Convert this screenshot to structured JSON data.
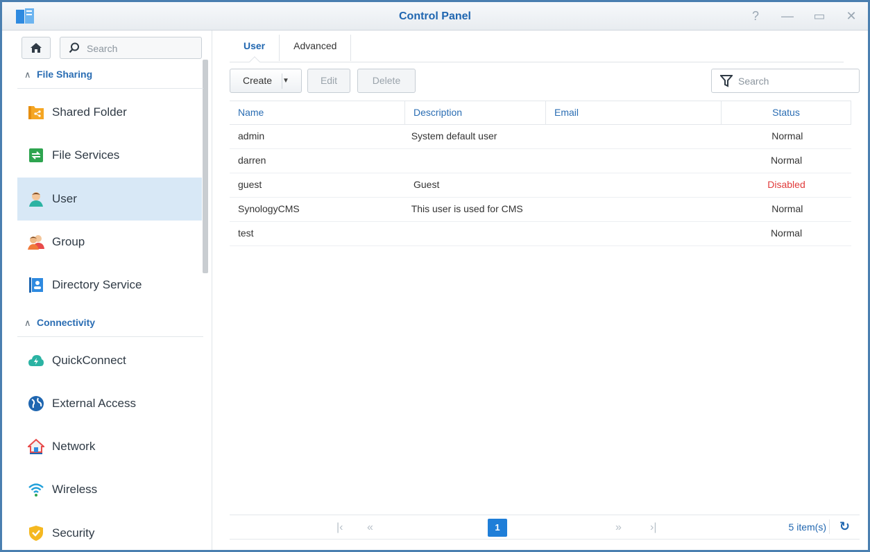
{
  "window": {
    "title": "Control Panel"
  },
  "sidebar": {
    "search_placeholder": "Search",
    "sections": [
      {
        "label": "File Sharing"
      },
      {
        "label": "Connectivity"
      }
    ],
    "items": [
      {
        "label": "Shared Folder",
        "icon": "shared-folder-icon"
      },
      {
        "label": "File Services",
        "icon": "file-services-icon"
      },
      {
        "label": "User",
        "icon": "user-icon"
      },
      {
        "label": "Group",
        "icon": "group-icon"
      },
      {
        "label": "Directory Service",
        "icon": "directory-service-icon"
      },
      {
        "label": "QuickConnect",
        "icon": "quickconnect-icon"
      },
      {
        "label": "External Access",
        "icon": "external-access-icon"
      },
      {
        "label": "Network",
        "icon": "network-icon"
      },
      {
        "label": "Wireless",
        "icon": "wireless-icon"
      },
      {
        "label": "Security",
        "icon": "security-icon"
      }
    ],
    "active_item": "User"
  },
  "main": {
    "tabs": [
      {
        "label": "User"
      },
      {
        "label": "Advanced"
      }
    ],
    "toolbar": {
      "create": "Create",
      "edit": "Edit",
      "delete": "Delete",
      "search_placeholder": "Search"
    },
    "grid": {
      "columns": [
        "Name",
        "Description",
        "Email",
        "Status"
      ],
      "rows": [
        {
          "name": "admin",
          "description": "System default user",
          "email": "",
          "status": "Normal"
        },
        {
          "name": "darren",
          "description": "",
          "email": "",
          "status": "Normal"
        },
        {
          "name": "guest",
          "description": "Guest",
          "email": "",
          "status": "Disabled"
        },
        {
          "name": "SynologyCMS",
          "description": "This user is used for CMS",
          "email": "",
          "status": "Normal"
        },
        {
          "name": "test",
          "description": "",
          "email": "",
          "status": "Normal"
        }
      ]
    },
    "pager": {
      "current_page": "1",
      "count": "5 item(s)"
    }
  },
  "colors": {
    "accent": "#1f66b0",
    "active_bg": "#d8e8f6",
    "disabled_status": "#e03a3a"
  }
}
